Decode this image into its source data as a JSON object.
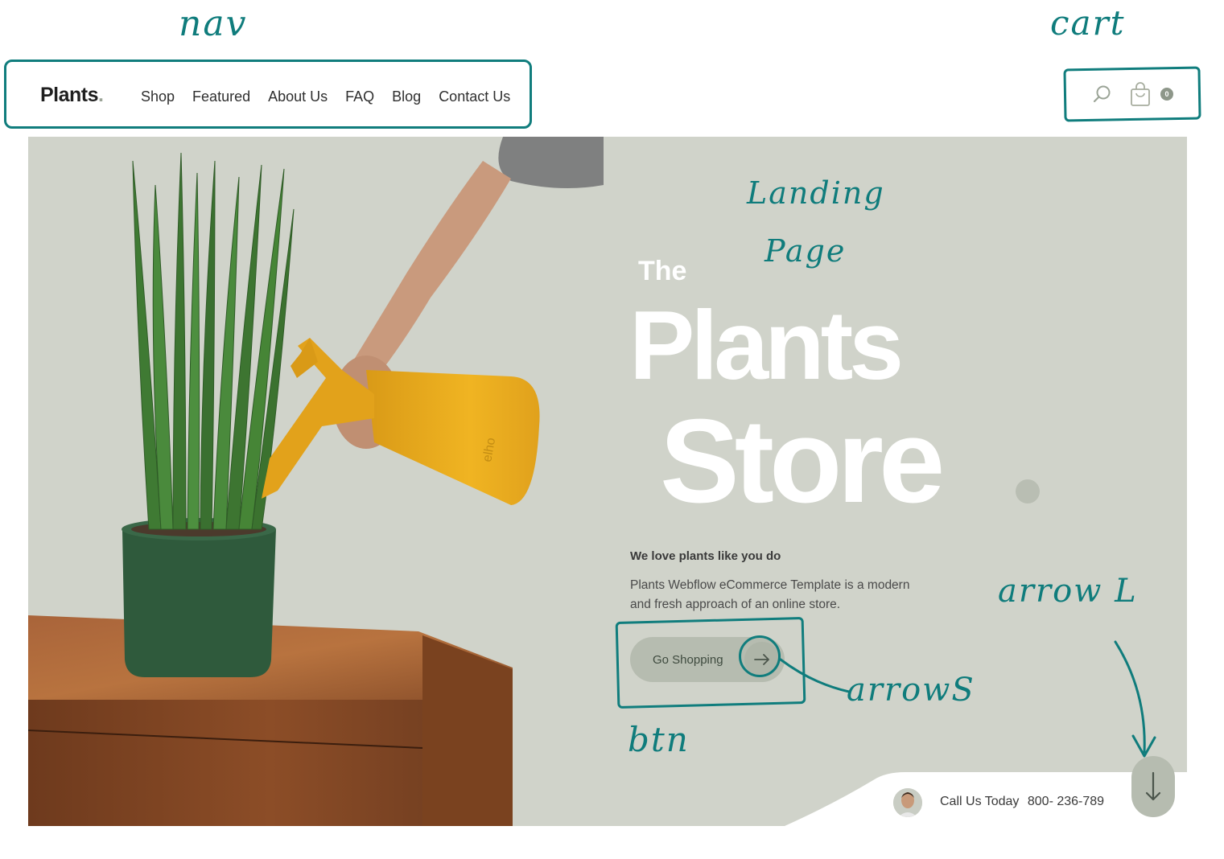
{
  "annotations": {
    "nav": "nav",
    "cart": "cart",
    "landing": "Landing",
    "page": "Page",
    "arrow_l": "arrow L",
    "arrows": "arrowS",
    "btn": "btn"
  },
  "header": {
    "logo": "Plants",
    "logo_dot": ".",
    "nav_items": [
      "Shop",
      "Featured",
      "About Us",
      "FAQ",
      "Blog",
      "Contact Us"
    ],
    "cart_count": "0"
  },
  "hero": {
    "the": "The",
    "plants": "Plants",
    "store": "Store",
    "tagline": "We love plants like you do",
    "description": "Plants Webflow eCommerce Template is a modern and fresh approach of an online store.",
    "cta_label": "Go Shopping",
    "call_label": "Call Us Today",
    "phone": "800- 236-789",
    "photo_brand": "elho"
  },
  "colors": {
    "hero_bg": "#d0d3ca",
    "accent": "#b6bcb0",
    "annotation": "#0f7c7c"
  }
}
